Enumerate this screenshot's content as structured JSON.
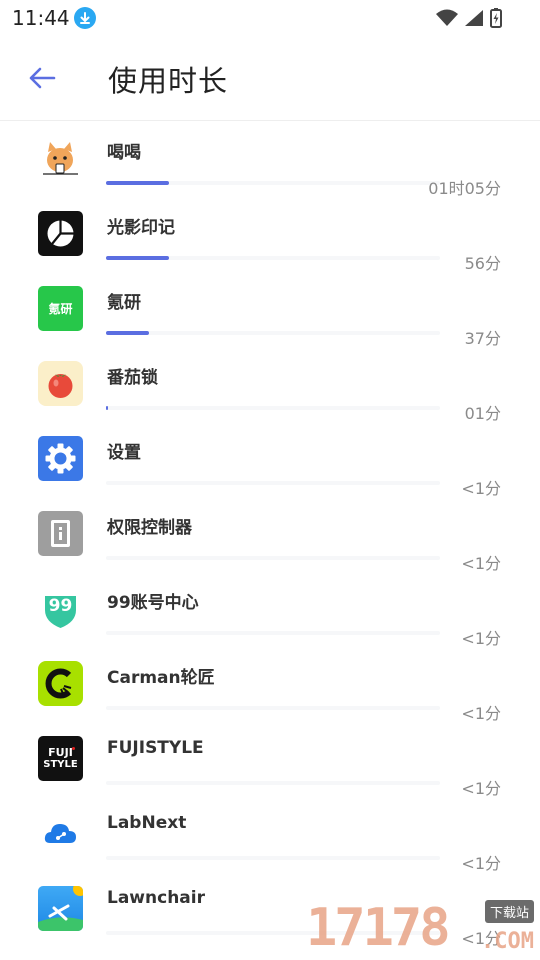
{
  "status_bar": {
    "time": "11:44"
  },
  "header": {
    "title": "使用时长"
  },
  "apps": [
    {
      "name": "喝喝",
      "duration": "01时05分",
      "progress": 0.19,
      "icon": "cat-icon"
    },
    {
      "name": "光影印记",
      "duration": "56分",
      "progress": 0.19,
      "icon": "camera-aperture-icon"
    },
    {
      "name": "氪研",
      "duration": "37分",
      "progress": 0.13,
      "icon_text": "氪研",
      "icon": "kryan-logo-icon"
    },
    {
      "name": "番茄锁",
      "duration": "01分",
      "progress": 0.006,
      "icon": "tomato-icon"
    },
    {
      "name": "设置",
      "duration": "<1分",
      "progress": 0,
      "icon": "settings-gear-icon"
    },
    {
      "name": "权限控制器",
      "duration": "<1分",
      "progress": 0,
      "icon": "permission-icon"
    },
    {
      "name": "99账号中心",
      "duration": "<1分",
      "progress": 0,
      "icon_text": "99",
      "icon": "99-account-icon"
    },
    {
      "name": "Carman轮匠",
      "duration": "<1分",
      "progress": 0,
      "icon": "carman-icon"
    },
    {
      "name": "FUJISTYLE",
      "duration": "<1分",
      "progress": 0,
      "icon_text_1": "FUJI",
      "icon_text_2": "STYLE",
      "icon": "fujistyle-logo-icon"
    },
    {
      "name": "LabNext",
      "duration": "<1分",
      "progress": 0,
      "icon": "labnext-cloud-icon"
    },
    {
      "name": "Lawnchair",
      "duration": "<1分",
      "progress": 0,
      "icon": "lawnchair-icon"
    }
  ],
  "watermark": {
    "number": "17178",
    "badge": "下载站",
    "suffix": ".COM"
  },
  "colors": {
    "bar_fill": "#5b6ee1",
    "bar_track": "#f6f7f9",
    "back_arrow": "#5b6ee1"
  }
}
